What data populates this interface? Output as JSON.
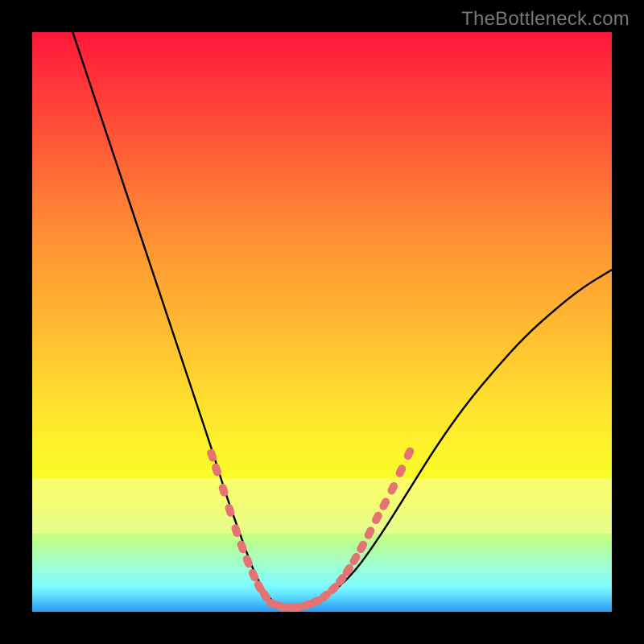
{
  "watermark": "TheBottleneck.com",
  "chart_data": {
    "type": "line",
    "title": "",
    "xlabel": "",
    "ylabel": "",
    "xlim": [
      0,
      100
    ],
    "ylim": [
      0,
      100
    ],
    "grid": false,
    "series": [
      {
        "name": "bottleneck-curve",
        "color": "#000000",
        "style": "solid",
        "x": [
          7,
          10,
          13,
          16,
          20,
          24,
          28,
          31,
          33.5,
          36,
          38,
          40,
          42,
          45,
          50,
          55,
          60,
          65,
          70,
          75,
          80,
          85,
          90,
          95,
          100
        ],
        "y": [
          100,
          91,
          82,
          73,
          61,
          49,
          37,
          28,
          20,
          13,
          7.5,
          3.5,
          1.2,
          0.7,
          2.0,
          6.0,
          13,
          21,
          29,
          36,
          42,
          47.5,
          52,
          56,
          59
        ]
      }
    ],
    "markers": [
      {
        "name": "left-cluster",
        "color": "#e57373",
        "shape": "rounded-rect",
        "points": [
          {
            "x": 31.0,
            "y": 27.0
          },
          {
            "x": 31.8,
            "y": 24.5
          },
          {
            "x": 33.0,
            "y": 21.0
          },
          {
            "x": 34.1,
            "y": 17.5
          },
          {
            "x": 35.2,
            "y": 14.0
          },
          {
            "x": 36.2,
            "y": 11.2
          },
          {
            "x": 37.2,
            "y": 8.7
          },
          {
            "x": 38.2,
            "y": 6.3
          },
          {
            "x": 39.2,
            "y": 4.3
          },
          {
            "x": 40.2,
            "y": 2.8
          }
        ]
      },
      {
        "name": "bottom-cluster",
        "color": "#e57373",
        "shape": "rounded-rect",
        "points": [
          {
            "x": 41.5,
            "y": 1.4
          },
          {
            "x": 43.0,
            "y": 0.9
          },
          {
            "x": 44.5,
            "y": 0.7
          },
          {
            "x": 46.0,
            "y": 0.8
          },
          {
            "x": 47.5,
            "y": 1.2
          },
          {
            "x": 49.0,
            "y": 1.8
          }
        ]
      },
      {
        "name": "right-cluster",
        "color": "#e57373",
        "shape": "rounded-rect",
        "points": [
          {
            "x": 50.5,
            "y": 2.7
          },
          {
            "x": 52.0,
            "y": 4.0
          },
          {
            "x": 53.3,
            "y": 5.5
          },
          {
            "x": 54.5,
            "y": 7.2
          },
          {
            "x": 55.7,
            "y": 9.1
          },
          {
            "x": 56.9,
            "y": 11.2
          },
          {
            "x": 58.2,
            "y": 13.6
          },
          {
            "x": 59.5,
            "y": 16.2
          },
          {
            "x": 60.8,
            "y": 18.6
          },
          {
            "x": 62.2,
            "y": 21.3
          },
          {
            "x": 63.6,
            "y": 24.3
          },
          {
            "x": 65.0,
            "y": 27.3
          }
        ]
      }
    ],
    "bands": [
      {
        "name": "pale-yellow-band",
        "y0": 77,
        "y1": 86.5,
        "color": "#fdfca2",
        "opacity": 0.55
      }
    ]
  }
}
